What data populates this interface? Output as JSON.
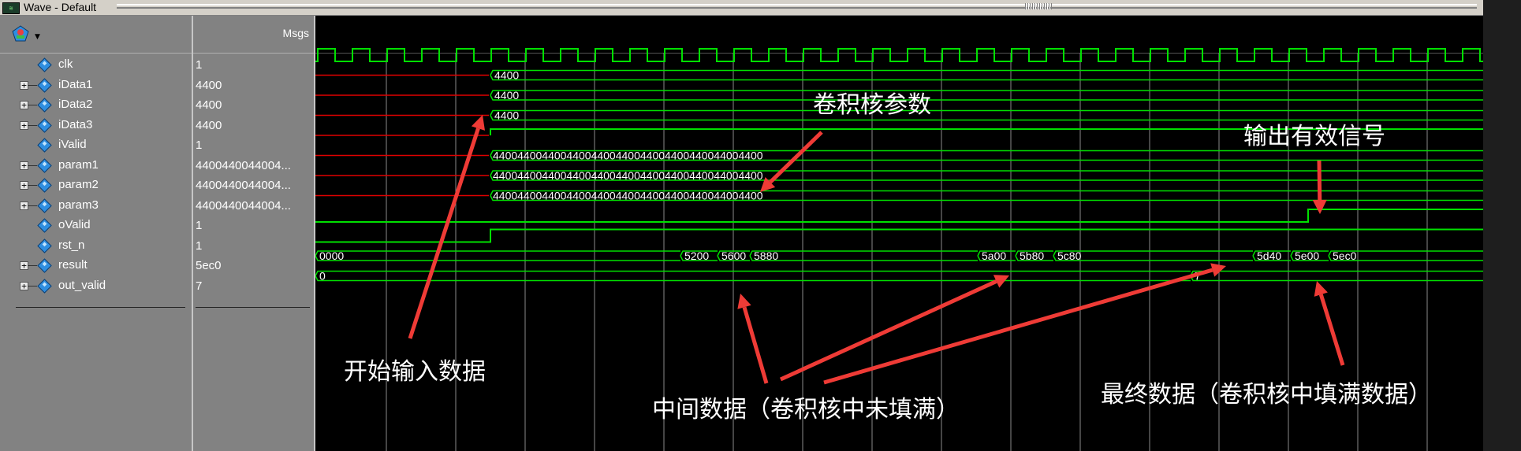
{
  "window": {
    "title": "Wave - Default",
    "icon": "wave-window-icon"
  },
  "header": {
    "msgs_label": "Msgs",
    "tool_icon": "wave-tools-icon"
  },
  "signals": [
    {
      "name": "clk",
      "value": "1",
      "expandable": false
    },
    {
      "name": "iData1",
      "value": "4400",
      "expandable": true
    },
    {
      "name": "iData2",
      "value": "4400",
      "expandable": true
    },
    {
      "name": "iData3",
      "value": "4400",
      "expandable": true
    },
    {
      "name": "iValid",
      "value": "1",
      "expandable": false
    },
    {
      "name": "param1",
      "value": "4400440044004...",
      "expandable": true
    },
    {
      "name": "param2",
      "value": "4400440044004...",
      "expandable": true
    },
    {
      "name": "param3",
      "value": "4400440044004...",
      "expandable": true
    },
    {
      "name": "oValid",
      "value": "1",
      "expandable": false
    },
    {
      "name": "rst_n",
      "value": "1",
      "expandable": false
    },
    {
      "name": "result",
      "value": "5ec0",
      "expandable": true
    },
    {
      "name": "out_valid",
      "value": "7",
      "expandable": true
    }
  ],
  "wave_labels": {
    "idata": "4400",
    "param": "44004400440044004400440044004400440044004400",
    "result_initial": "0000",
    "result_values": [
      "5200",
      "5600",
      "5880",
      "5a00",
      "5b80",
      "5c80",
      "5d40",
      "5e00",
      "5ec0"
    ],
    "out_valid_initial": "0",
    "out_valid_final": "7"
  },
  "annotations": {
    "start_input": "开始输入数据",
    "kernel_params": "卷积核参数",
    "output_valid": "输出有效信号",
    "intermediate": "中间数据（卷积核中未填满）",
    "final": "最终数据（卷积核中填满数据）"
  },
  "colors": {
    "wave": "#00e000",
    "undefined": "#e00000",
    "grid": "#8a8a8a",
    "arrow": "#ef3b36",
    "panel": "#828282"
  }
}
